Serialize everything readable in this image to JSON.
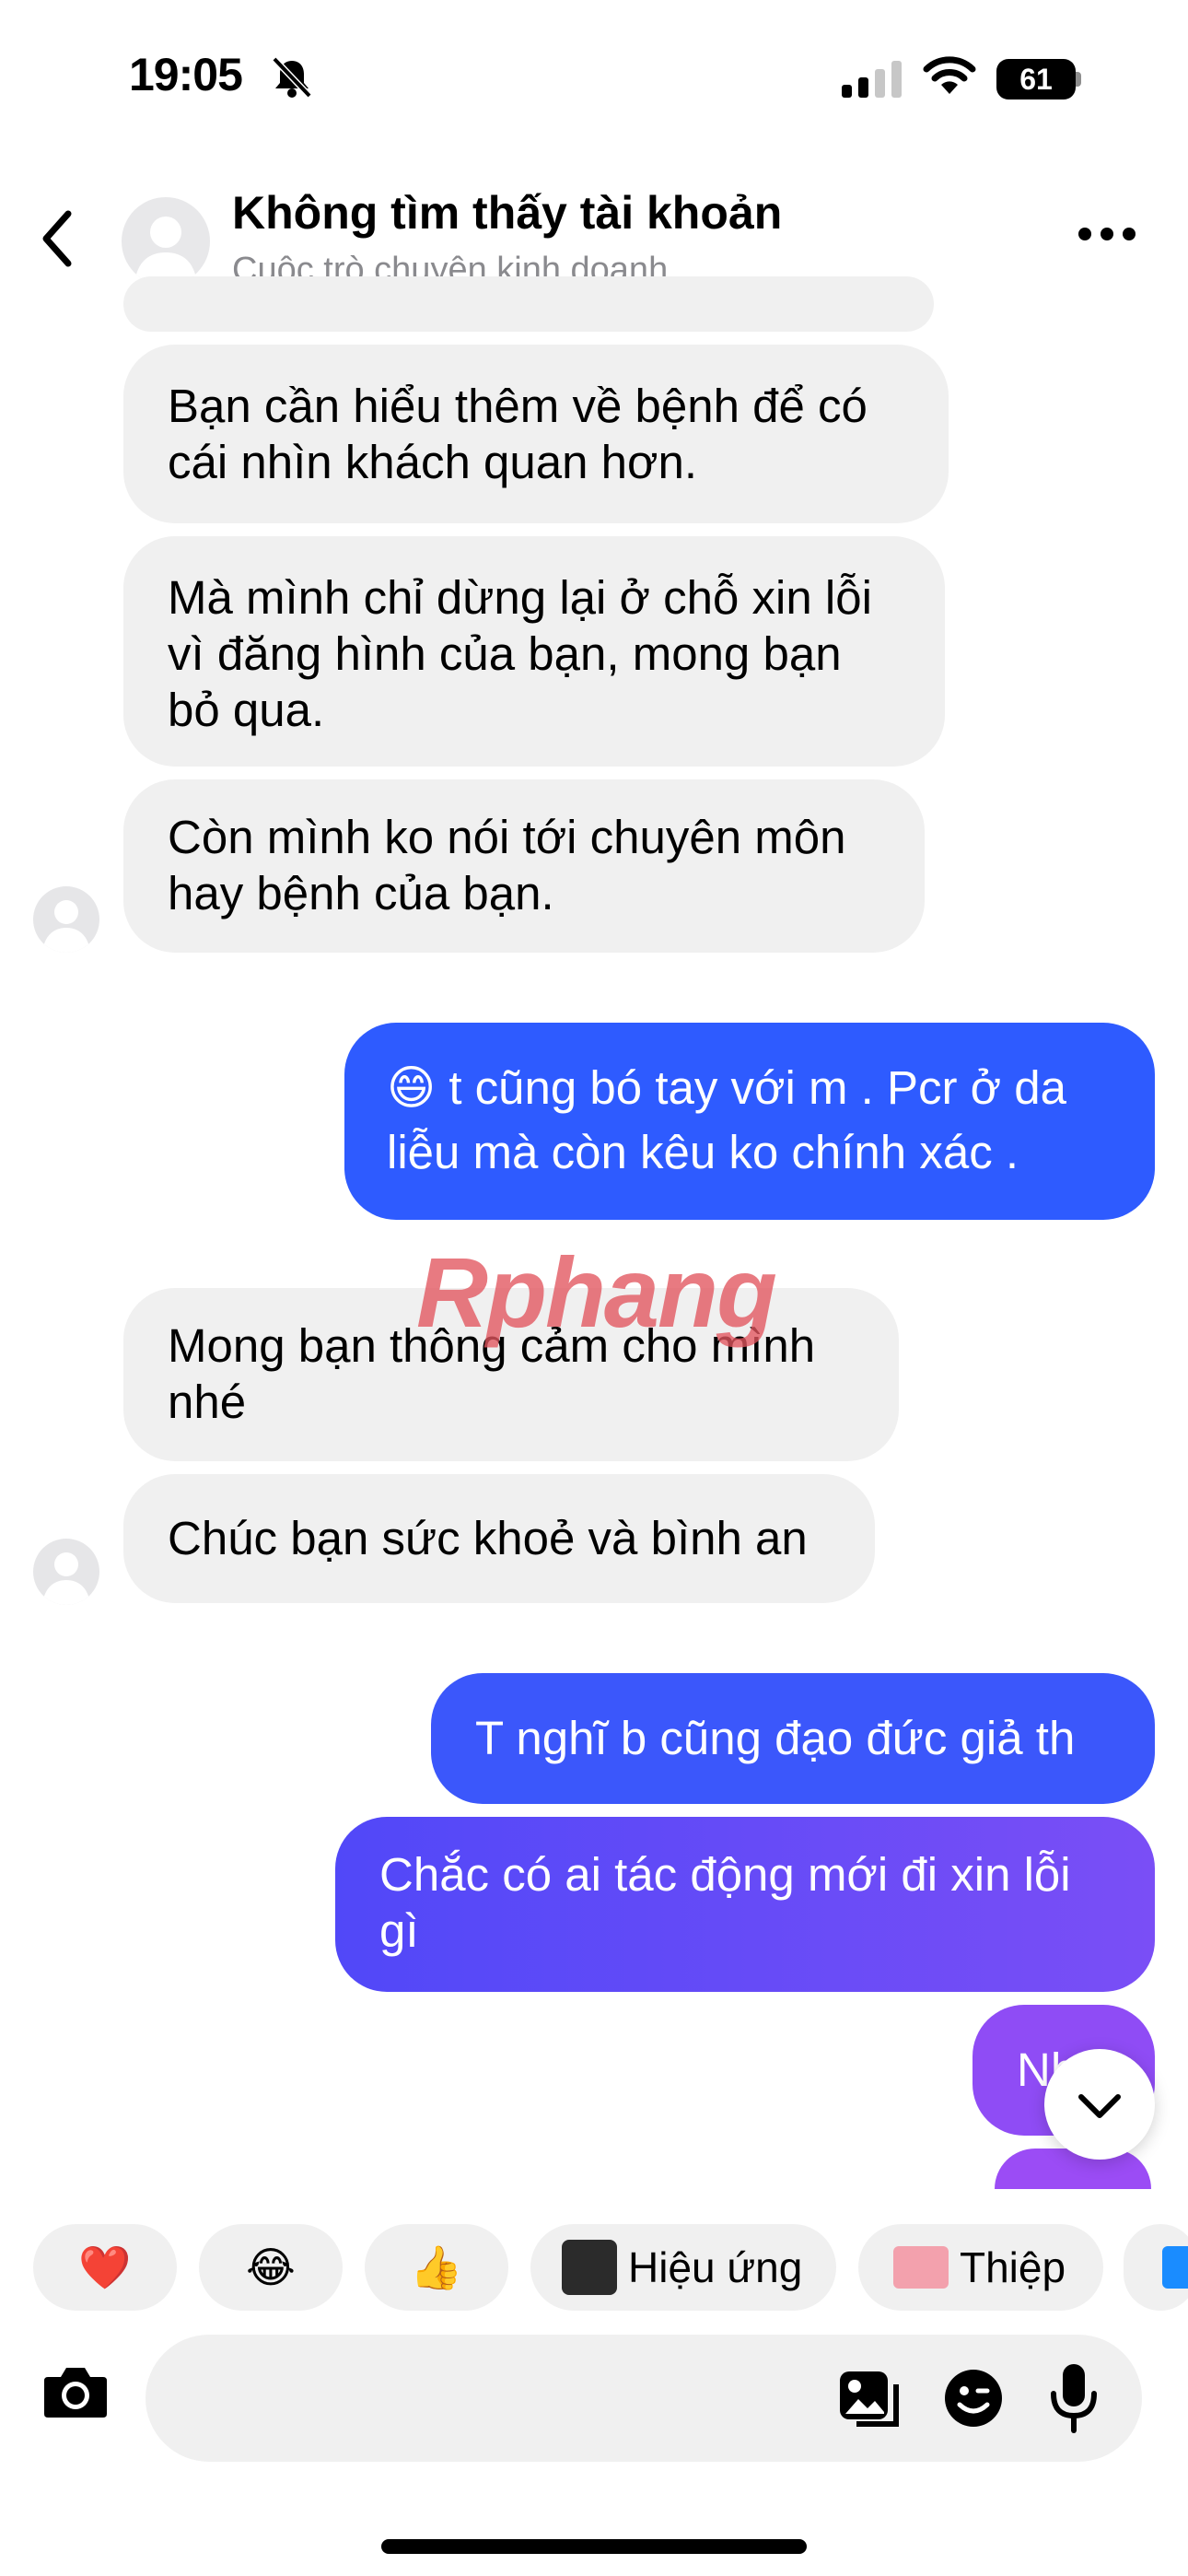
{
  "status_bar": {
    "time": "19:05",
    "battery": "61"
  },
  "header": {
    "title": "Không tìm thấy tài khoản",
    "subtitle": "Cuộc trò chuyện kinh doanh"
  },
  "messages": [
    {
      "from": "them",
      "text": "Bạn cần hiểu thêm về bệnh để có cái nhìn khách quan hơn."
    },
    {
      "from": "them",
      "text": "Mà mình chỉ dừng lại ở chỗ xin lỗi vì đăng hình của bạn, mong bạn bỏ qua."
    },
    {
      "from": "them",
      "text": "Còn mình ko nói tới chuyên môn hay bệnh của bạn."
    },
    {
      "from": "me",
      "text": "😄 t cũng bó tay với m . Pcr ở da liễu mà còn kêu ko chính xác ."
    },
    {
      "from": "them",
      "text": "Mong bạn thông cảm cho mình nhé"
    },
    {
      "from": "them",
      "text": "Chúc bạn sức khoẻ và bình an"
    },
    {
      "from": "me",
      "text": "T nghĩ b cũng đạo đức giả th"
    },
    {
      "from": "me",
      "text": "Chắc có ai tác động mới đi xin lỗi gì"
    },
    {
      "from": "me",
      "text": "Nh"
    }
  ],
  "watermark": "Rphang",
  "quick_reactions": {
    "heart": "❤️",
    "laugh": "😂",
    "thumbs_up": "👍",
    "effects_label": "Hiệu ứng",
    "card_label": "Thiệp"
  },
  "colors": {
    "incoming_bubble": "#f0f0f0",
    "outgoing_top": "#2e5bff",
    "outgoing_bottom": "#9b4cf5"
  }
}
